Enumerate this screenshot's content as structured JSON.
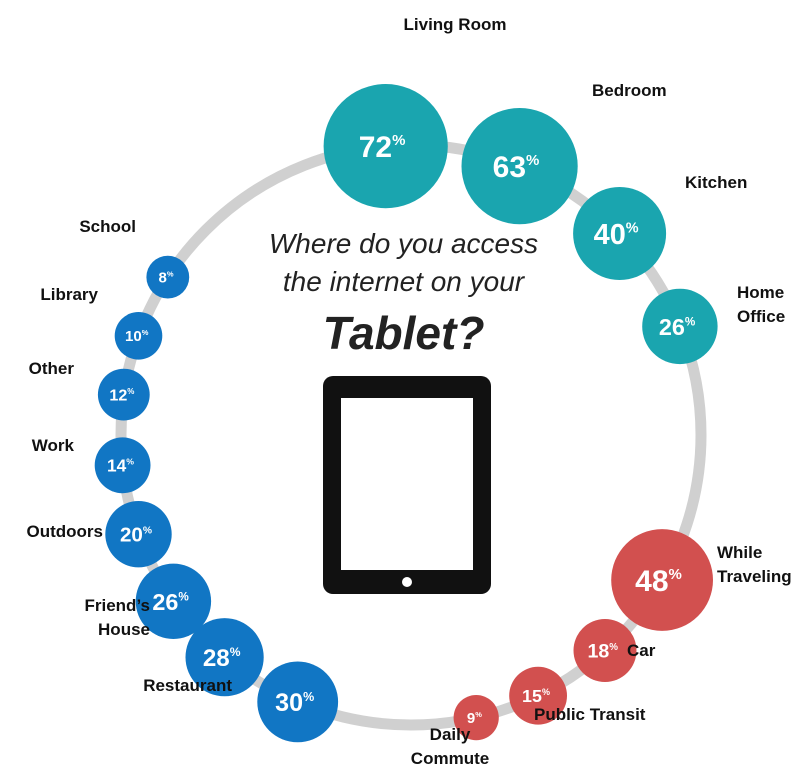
{
  "title": {
    "line1": "Where do you access",
    "line2": "the internet on your",
    "line3": "Tablet?"
  },
  "colors": {
    "home": "#1AA5AF",
    "other": "#1176C4",
    "travel": "#D2504F",
    "ring": "#D0D0D0",
    "tablet": "#111111"
  },
  "chart_data": {
    "type": "bubble",
    "unit": "%",
    "points": [
      {
        "label": "Living Room",
        "value": 72,
        "group": "home"
      },
      {
        "label": "Bedroom",
        "value": 63,
        "group": "home"
      },
      {
        "label": "Kitchen",
        "value": 40,
        "group": "home"
      },
      {
        "label": "Home Office",
        "value": 26,
        "group": "home"
      },
      {
        "label": "While Traveling",
        "value": 48,
        "group": "travel"
      },
      {
        "label": "Car",
        "value": 18,
        "group": "travel"
      },
      {
        "label": "Public Transit",
        "value": 15,
        "group": "travel"
      },
      {
        "label": "Daily Commute",
        "value": 9,
        "group": "travel"
      },
      {
        "label": "Restaurant",
        "value": 30,
        "group": "other"
      },
      {
        "label": "Friend’s House",
        "value": 28,
        "group": "other"
      },
      {
        "label": "Outdoors",
        "value": 26,
        "group": "other"
      },
      {
        "label": "Work",
        "value": 20,
        "group": "other"
      },
      {
        "label": "Other",
        "value": 14,
        "group": "other"
      },
      {
        "label": "Library",
        "value": 12,
        "group": "other"
      },
      {
        "label": "School",
        "value": 10,
        "group": "other"
      },
      {
        "label": "",
        "value": 8,
        "group": "other"
      }
    ]
  }
}
